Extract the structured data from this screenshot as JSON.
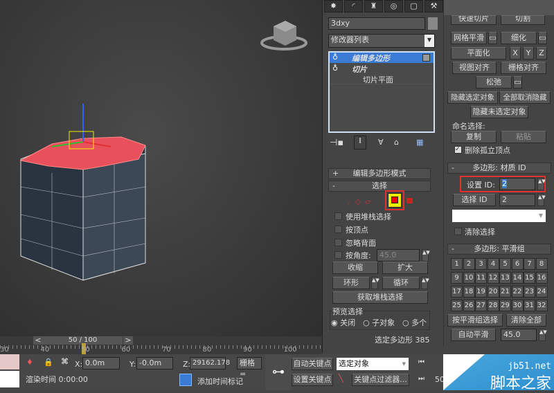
{
  "timeline": {
    "frame": "50 / 100",
    "prev": "<",
    "next": ">",
    "ticks": [
      "30",
      "40",
      "50",
      "60",
      "70",
      "80",
      "90",
      "100"
    ]
  },
  "status": {
    "x_label": "X:",
    "x": "0.0m",
    "y_label": "Y:",
    "y": "-0.0m",
    "z_label": "Z:",
    "z": "29162.178",
    "grid": "栅格 =",
    "render_time": "渲染时间  0:00:00",
    "add_time_tag": "添加时间标记",
    "auto_key": "自动关键点",
    "set_key": "设置关键点",
    "key_mode": "选定对象",
    "key_filters": "关键点过滤器...",
    "frame_value": "50"
  },
  "watermark": {
    "site": "jb51.net",
    "name": "脚本之家"
  },
  "modify": {
    "object_name": "3dxy",
    "modifier_list": "修改器列表",
    "stack": [
      {
        "label": "编辑多边形",
        "active": true
      },
      {
        "label": "切片",
        "active": false
      },
      {
        "label": "切片平面",
        "sub": true
      }
    ]
  },
  "rollouts": {
    "edit_poly_mode": "编辑多边形模式",
    "selection": "选择",
    "use_stack": "使用堆栈选择",
    "by_vertex": "按顶点",
    "ignore_back": "忽略背面",
    "by_angle": "按角度:",
    "angle": "45.0",
    "shrink": "收缩",
    "grow": "扩大",
    "ring": "环形",
    "loop": "循环",
    "get_stack": "获取堆栈选择",
    "preview": "预览选择",
    "preview_off": "关闭",
    "preview_sub": "子对象",
    "preview_multi": "多个",
    "selected": "选定多边形 385"
  },
  "geometry": {
    "quick_slice": "快速切片",
    "cut": "切割",
    "meshsmooth": "网格平滑",
    "tessellate": "细化",
    "planarize": "平面化",
    "x": "X",
    "y": "Y",
    "z": "Z",
    "view_align": "视图对齐",
    "grid_align": "栅格对齐",
    "relax": "松弛",
    "hide_sel": "隐藏选定对象",
    "unhide_all": "全部取消隐藏",
    "hide_unsel": "隐藏未选定对象",
    "named_sel": "命名选择:",
    "copy": "复制",
    "paste": "粘贴",
    "delete_iso": "删除孤立顶点"
  },
  "material_id": {
    "title": "多边形: 材质 ID",
    "set_id": "设置 ID:",
    "set_id_value": "2",
    "select_id": "选择 ID",
    "select_id_value": "2",
    "clear": "清除选择"
  },
  "smoothing": {
    "title": "多边形: 平滑组",
    "groups": [
      "1",
      "2",
      "3",
      "4",
      "5",
      "6",
      "7",
      "8",
      "9",
      "10",
      "11",
      "12",
      "13",
      "14",
      "15",
      "16",
      "17",
      "18",
      "19",
      "20",
      "21",
      "22",
      "23",
      "24",
      "25",
      "26",
      "27",
      "28",
      "29",
      "30",
      "31",
      "32"
    ],
    "select_by": "按平滑组选择",
    "clear_all": "清除全部",
    "auto_smooth": "自动平滑",
    "auto_value": "45.0"
  },
  "colors": {
    "accent": "#3a7bd5",
    "selection": "#e8505b",
    "highlight": "#e03030"
  }
}
